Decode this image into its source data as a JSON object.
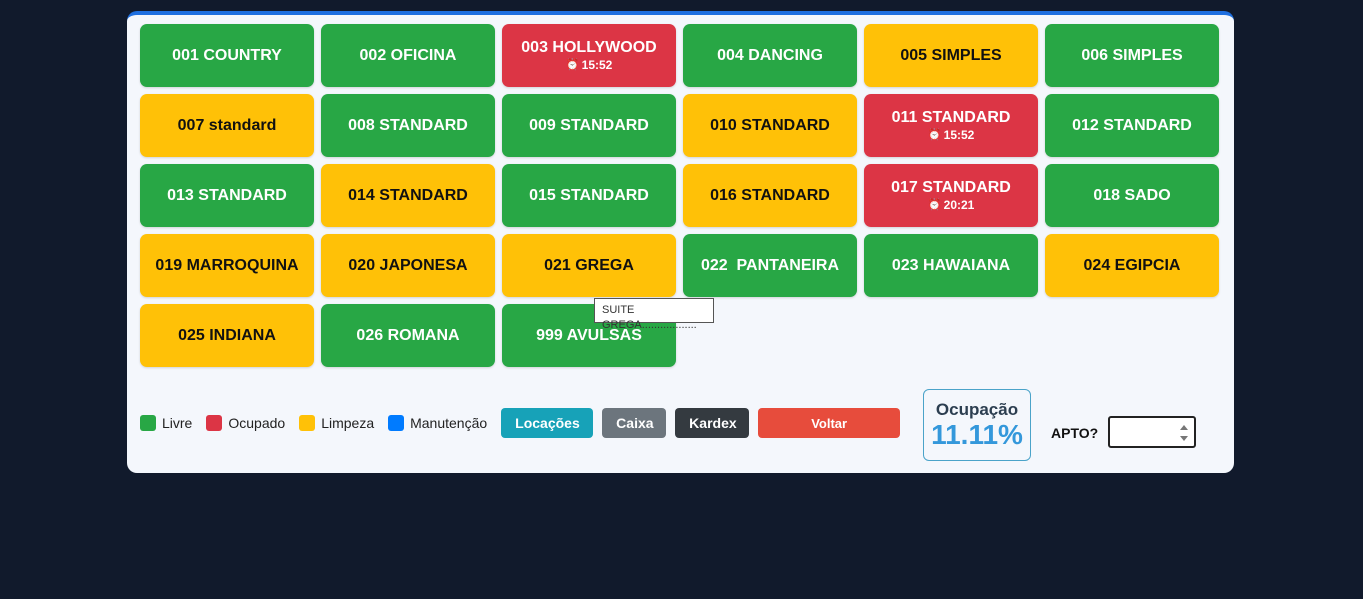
{
  "rooms": [
    {
      "label": "001 COUNTRY",
      "status": "livre"
    },
    {
      "label": "002 OFICINA",
      "status": "livre"
    },
    {
      "label": "003 HOLLYWOOD",
      "status": "ocupado",
      "time": "15:52"
    },
    {
      "label": "004 DANCING",
      "status": "livre"
    },
    {
      "label": "005 SIMPLES",
      "status": "limpeza"
    },
    {
      "label": "006 SIMPLES",
      "status": "livre"
    },
    {
      "label": "007 standard",
      "status": "limpeza"
    },
    {
      "label": "008 STANDARD",
      "status": "livre"
    },
    {
      "label": "009 STANDARD",
      "status": "livre"
    },
    {
      "label": "010 STANDARD",
      "status": "limpeza"
    },
    {
      "label": "011 STANDARD",
      "status": "ocupado",
      "time": "15:52"
    },
    {
      "label": "012 STANDARD",
      "status": "livre"
    },
    {
      "label": "013 STANDARD",
      "status": "livre"
    },
    {
      "label": "014 STANDARD",
      "status": "limpeza"
    },
    {
      "label": "015 STANDARD",
      "status": "livre"
    },
    {
      "label": "016 STANDARD",
      "status": "limpeza"
    },
    {
      "label": "017 STANDARD",
      "status": "ocupado",
      "time": "20:21"
    },
    {
      "label": "018 SADO",
      "status": "livre"
    },
    {
      "label": "019 MARROQUINA",
      "status": "limpeza"
    },
    {
      "label": "020 JAPONESA",
      "status": "limpeza"
    },
    {
      "label": "021 GREGA",
      "status": "limpeza"
    },
    {
      "label": "022  PANTANEIRA",
      "status": "livre"
    },
    {
      "label": "023 HAWAIANA",
      "status": "livre"
    },
    {
      "label": "024 EGIPCIA",
      "status": "limpeza"
    },
    {
      "label": "025 INDIANA",
      "status": "limpeza"
    },
    {
      "label": "026 ROMANA",
      "status": "livre"
    },
    {
      "label": "999 AVULSAS",
      "status": "livre"
    }
  ],
  "tooltip": "SUITE GREGA..................",
  "legend": {
    "livre": "Livre",
    "ocupado": "Ocupado",
    "limpeza": "Limpeza",
    "manutencao": "Manutenção"
  },
  "colors": {
    "livre": "#28a745",
    "ocupado": "#dc3545",
    "limpeza": "#ffc107",
    "manutencao": "#007bff"
  },
  "buttons": {
    "locacoes": "Locações",
    "caixa": "Caixa",
    "kardex": "Kardex",
    "voltar": "Voltar"
  },
  "ocupacao": {
    "label": "Ocupação",
    "value": "11.11%"
  },
  "apto": {
    "label": "APTO?",
    "value": ""
  },
  "icons": {
    "clock": "alarm-clock-icon"
  }
}
